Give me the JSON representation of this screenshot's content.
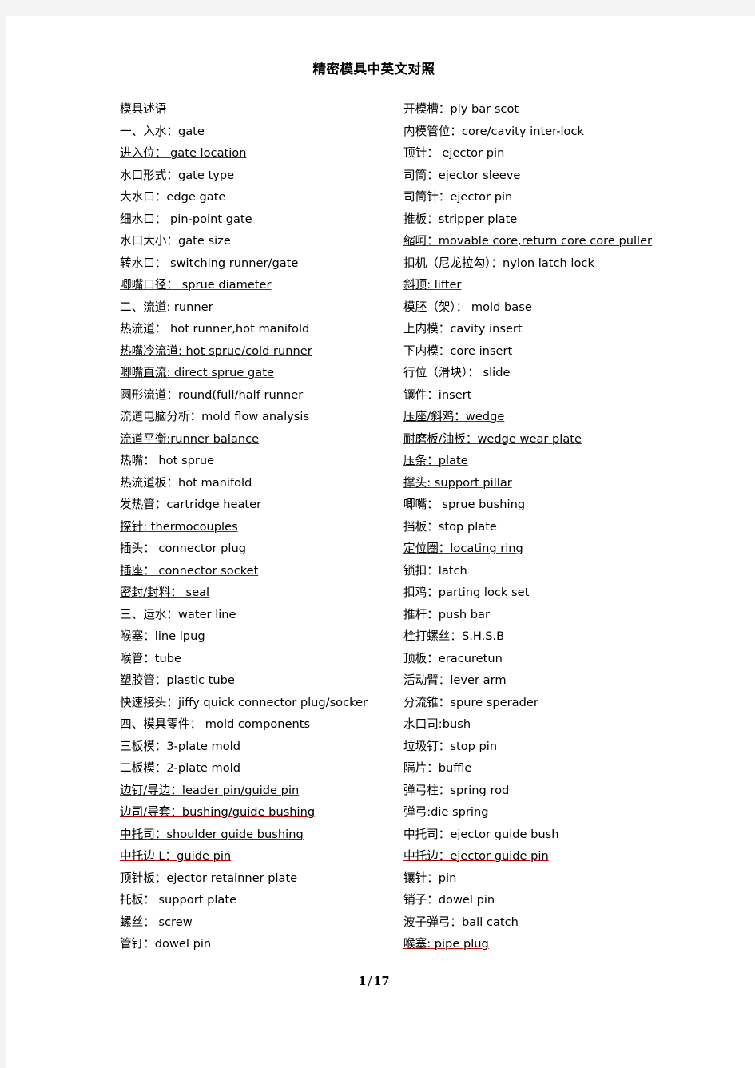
{
  "document": {
    "title": "精密模具中英文对照",
    "background_color": "#f4f4f4",
    "page_color": "#ffffff",
    "spellcheck_underline_color": "#c00000"
  },
  "footer": {
    "current_page": "1",
    "separator": "/",
    "total_pages": "17",
    "full": "1 / 17"
  },
  "columns": {
    "left": {
      "entries": [
        {
          "text": "模具述语",
          "underlined": false
        },
        {
          "text": "一、入水：gate",
          "underlined": false
        },
        {
          "text": "进入位：  gate location",
          "underlined": true
        },
        {
          "text": "水口形式：gate type",
          "underlined": false
        },
        {
          "text": "大水口：edge gate",
          "underlined": false
        },
        {
          "text": "细水口：  pin-point gate",
          "underlined": false
        },
        {
          "text": "水口大小：gate size",
          "underlined": false
        },
        {
          "text": "转水口：  switching runner/gate",
          "underlined": false
        },
        {
          "text": "唧嘴口径：  sprue diameter",
          "underlined": true
        },
        {
          "text": "二、流道: runner",
          "underlined": false
        },
        {
          "text": "热流道：  hot runner,hot manifold",
          "underlined": false
        },
        {
          "text": "热嘴冷流道: hot sprue/cold runner",
          "underlined": true
        },
        {
          "text": "唧嘴直流: direct sprue gate",
          "underlined": true
        },
        {
          "text": "圆形流道：round(full/half runner",
          "underlined": false
        },
        {
          "text": "流道电脑分析：mold flow analysis",
          "underlined": false
        },
        {
          "text": "流道平衡:runner balance",
          "underlined": true
        },
        {
          "text": "热嘴：  hot sprue",
          "underlined": false
        },
        {
          "text": "热流道板：hot manifold",
          "underlined": false
        },
        {
          "text": "发热管：cartridge heater",
          "underlined": false
        },
        {
          "text": "探针: thermocouples",
          "underlined": true
        },
        {
          "text": "插头：  connector plug",
          "underlined": false
        },
        {
          "text": "插座：  connector socket",
          "underlined": true
        },
        {
          "text": "密封/封料：  seal",
          "underlined": true
        },
        {
          "text": "三、运水：water line",
          "underlined": false
        },
        {
          "text": "喉塞：line lpug",
          "underlined": true
        },
        {
          "text": "喉管：tube",
          "underlined": false
        },
        {
          "text": "塑胶管：plastic tube",
          "underlined": false
        },
        {
          "text": "快速接头：jiffy quick connector plug/socker",
          "underlined": false
        },
        {
          "text": "四、模具零件：  mold components",
          "underlined": false
        },
        {
          "text": "三板模：3-plate mold",
          "underlined": false
        },
        {
          "text": "二板模：2-plate mold",
          "underlined": false
        },
        {
          "text": "边钉/导边：leader pin/guide pin",
          "underlined": true
        },
        {
          "text": "边司/导套：bushing/guide bushing",
          "underlined": true
        },
        {
          "text": "中托司：shoulder guide bushing",
          "underlined": true
        },
        {
          "text": "中托边 L：guide pin",
          "underlined": true
        },
        {
          "text": "顶针板：ejector retainner plate",
          "underlined": false
        },
        {
          "text": "托板：  support plate",
          "underlined": false
        },
        {
          "text": "螺丝：  screw",
          "underlined": true
        },
        {
          "text": "管钉：dowel pin",
          "underlined": false
        }
      ]
    },
    "right": {
      "entries": [
        {
          "text": "开模槽：ply bar scot",
          "underlined": false
        },
        {
          "text": "内模管位：core/cavity inter-lock",
          "underlined": false
        },
        {
          "text": "顶针：  ejector pin",
          "underlined": false
        },
        {
          "text": "司筒：ejector sleeve",
          "underlined": false
        },
        {
          "text": "司筒针：ejector pin",
          "underlined": false
        },
        {
          "text": "推板：stripper plate",
          "underlined": false
        },
        {
          "text": "缩呵：movable core,return core core puller",
          "underlined": true
        },
        {
          "text": "扣机（尼龙拉勾）：nylon latch lock",
          "underlined": false
        },
        {
          "text": "斜顶: lifter",
          "underlined": true
        },
        {
          "text": "模胚（架）：  mold base",
          "underlined": false
        },
        {
          "text": "上内模：cavity insert",
          "underlined": false
        },
        {
          "text": "下内模：core insert",
          "underlined": false
        },
        {
          "text": "行位（滑块）：  slide",
          "underlined": false
        },
        {
          "text": "镶件：insert",
          "underlined": false
        },
        {
          "text": "压座/斜鸡：wedge",
          "underlined": true
        },
        {
          "text": "耐磨板/油板：wedge wear plate",
          "underlined": true
        },
        {
          "text": "压条：plate",
          "underlined": true
        },
        {
          "text": "撑头: support pillar",
          "underlined": true
        },
        {
          "text": "唧嘴：  sprue bushing",
          "underlined": false
        },
        {
          "text": "挡板：stop plate",
          "underlined": false
        },
        {
          "text": "定位圈：locating ring",
          "underlined": true
        },
        {
          "text": "锁扣：latch",
          "underlined": false
        },
        {
          "text": "扣鸡：parting lock set",
          "underlined": false
        },
        {
          "text": "推杆：push bar",
          "underlined": false
        },
        {
          "text": "栓打螺丝：S.H.S.B",
          "underlined": true
        },
        {
          "text": "顶板：eracuretun",
          "underlined": false
        },
        {
          "text": "活动臂：lever arm",
          "underlined": false
        },
        {
          "text": "分流锥：spure sperader",
          "underlined": false
        },
        {
          "text": "水口司:bush",
          "underlined": false
        },
        {
          "text": "垃圾钉：stop pin",
          "underlined": false
        },
        {
          "text": "隔片：buffle",
          "underlined": false
        },
        {
          "text": "弹弓柱：spring rod",
          "underlined": false
        },
        {
          "text": "弹弓:die spring",
          "underlined": false
        },
        {
          "text": "中托司：ejector guide bush",
          "underlined": false
        },
        {
          "text": "中托边：ejector guide pin",
          "underlined": true
        },
        {
          "text": "镶针：pin",
          "underlined": false
        },
        {
          "text": "销子：dowel pin",
          "underlined": false
        },
        {
          "text": "波子弹弓：ball catch",
          "underlined": false
        },
        {
          "text": "喉塞: pipe plug",
          "underlined": true
        }
      ]
    }
  }
}
